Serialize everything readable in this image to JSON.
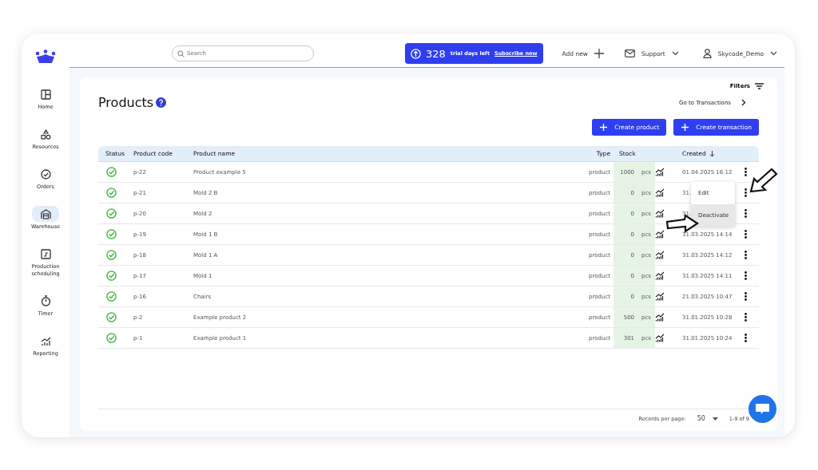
{
  "sidebar": {
    "items": [
      {
        "label": "Home",
        "selected": false
      },
      {
        "label": "Resources",
        "selected": false
      },
      {
        "label": "Orders",
        "selected": false
      },
      {
        "label": "Warehouse",
        "selected": true
      },
      {
        "label": "Production scheduling",
        "selected": false
      },
      {
        "label": "Timer",
        "selected": false
      },
      {
        "label": "Reporting",
        "selected": false
      }
    ]
  },
  "topbar": {
    "search": {
      "placeholder": "Search"
    },
    "trial": {
      "days": "328",
      "text": "trial days left",
      "link": "Subscribe now"
    },
    "add_new": "Add new",
    "support": "Support",
    "user": "Skycode_Demo"
  },
  "page": {
    "title": "Products",
    "filters": "Filters",
    "go_to": "Go to Transactions",
    "buttons": [
      "Create product",
      "Create transaction"
    ]
  },
  "table": {
    "columns": [
      "Status",
      "Product code",
      "Product name",
      "Type",
      "Stock",
      "Created"
    ],
    "rows": [
      {
        "active": true,
        "code": "p-22",
        "name": "Product example 5",
        "type": "product",
        "stock": "1000",
        "unit": "pcs",
        "created": "01.04.2025 16:12"
      },
      {
        "active": true,
        "code": "p-21",
        "name": "Mold 2 B",
        "type": "product",
        "stock": "0",
        "unit": "pcs",
        "created": "31."
      },
      {
        "active": true,
        "code": "p-20",
        "name": "Mold 2",
        "type": "product",
        "stock": "0",
        "unit": "pcs",
        "created": "31."
      },
      {
        "active": true,
        "code": "p-19",
        "name": "Mold 1 B",
        "type": "product",
        "stock": "0",
        "unit": "pcs",
        "created": "31.03.2025 14:14"
      },
      {
        "active": true,
        "code": "p-18",
        "name": "Mold 1 A",
        "type": "product",
        "stock": "0",
        "unit": "pcs",
        "created": "31.03.2025 14:12"
      },
      {
        "active": true,
        "code": "p-17",
        "name": "Mold 1",
        "type": "product",
        "stock": "0",
        "unit": "pcs",
        "created": "31.03.2025 14:11"
      },
      {
        "active": true,
        "code": "p-16",
        "name": "Chairs",
        "type": "product",
        "stock": "0",
        "unit": "pcs",
        "created": "21.03.2025 10:47"
      },
      {
        "active": true,
        "code": "p-2",
        "name": "Example product 2",
        "type": "product",
        "stock": "500",
        "unit": "pcs",
        "created": "31.01.2025 10:28"
      },
      {
        "active": true,
        "code": "p-1",
        "name": "Example product 1",
        "type": "product",
        "stock": "301",
        "unit": "pcs",
        "created": "31.01.2025 10:24"
      }
    ]
  },
  "row_menu": {
    "items": [
      {
        "label": "Edit",
        "highlighted": false
      },
      {
        "label": "Deactivate",
        "highlighted": true
      }
    ]
  },
  "pagination": {
    "label": "Records per page:",
    "per_page": "50",
    "range": "1-9 of 9"
  }
}
